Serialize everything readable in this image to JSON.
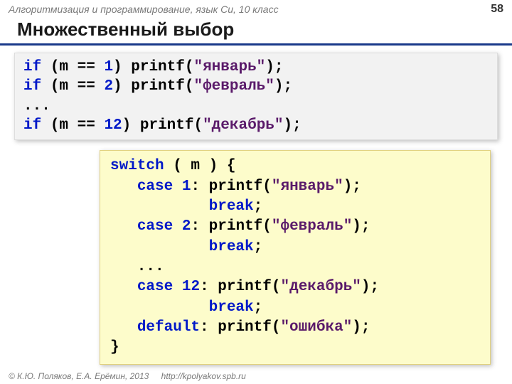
{
  "header": {
    "course": "Алгоритмизация и программирование, язык Си, 10 класс",
    "page": "58"
  },
  "title": "Множественный выбор",
  "code1": {
    "l1": {
      "kw": "if",
      "t1": " (m == ",
      "n": "1",
      "t2": ") printf(",
      "s": "\"январь\"",
      "t3": ");"
    },
    "l2": {
      "kw": "if",
      "t1": " (m == ",
      "n": "2",
      "t2": ") printf(",
      "s": "\"февраль\"",
      "t3": ");"
    },
    "l3": "...",
    "l4": {
      "kw": "if",
      "t1": " (m == ",
      "n": "12",
      "t2": ") printf(",
      "s": "\"декабрь\"",
      "t3": ");"
    }
  },
  "code2": {
    "l1": {
      "kw": "switch",
      "t": " ( m ) {"
    },
    "l2": {
      "ind": "   ",
      "kw": "case",
      "sp": " ",
      "n": "1",
      "t1": ": printf(",
      "s": "\"январь\"",
      "t2": ");"
    },
    "l3": {
      "ind": "           ",
      "kw": "break",
      "t": ";"
    },
    "l4": {
      "ind": "   ",
      "kw": "case",
      "sp": " ",
      "n": "2",
      "t1": ": printf(",
      "s": "\"февраль\"",
      "t2": ");"
    },
    "l5": {
      "ind": "           ",
      "kw": "break",
      "t": ";"
    },
    "l6": "   ...",
    "l7": {
      "ind": "   ",
      "kw": "case",
      "sp": " ",
      "n": "12",
      "t1": ": printf(",
      "s": "\"декабрь\"",
      "t2": ");"
    },
    "l8": {
      "ind": "           ",
      "kw": "break",
      "t": ";"
    },
    "l9": {
      "ind": "   ",
      "kw": "default",
      "t1": ": printf(",
      "s": "\"ошибка\"",
      "t2": ");"
    },
    "l10": "}"
  },
  "footer": {
    "copy": "© К.Ю. Поляков, Е.А. Ерёмин, 2013",
    "link": "http://kpolyakov.spb.ru"
  }
}
